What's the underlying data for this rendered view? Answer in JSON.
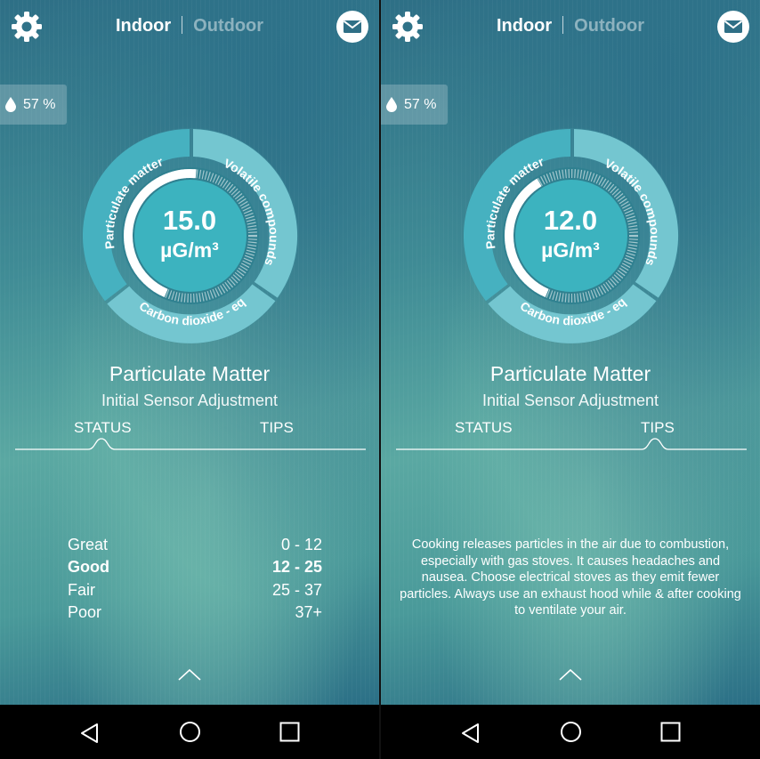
{
  "screens": [
    {
      "header": {
        "tab_indoor": "Indoor",
        "tab_outdoor": "Outdoor",
        "settings_icon": "gear-icon",
        "mail_icon": "mail-icon"
      },
      "humidity": "57 %",
      "dial": {
        "segments": [
          "Particulate matter",
          "Volatile compounds",
          "Carbon dioxide - eq"
        ],
        "value": "15.0",
        "unit": "µG/m³",
        "gauge_fill_fraction": 0.45
      },
      "title": "Particulate Matter",
      "subtitle": "Initial Sensor Adjustment",
      "tabs": {
        "status": "STATUS",
        "tips": "TIPS",
        "active": "status"
      },
      "ranges": [
        {
          "label": "Great",
          "range": "0 - 12"
        },
        {
          "label": "Good",
          "range": "12 - 25",
          "highlight": true
        },
        {
          "label": "Fair",
          "range": "25 - 37"
        },
        {
          "label": "Poor",
          "range": "37+"
        }
      ]
    },
    {
      "header": {
        "tab_indoor": "Indoor",
        "tab_outdoor": "Outdoor",
        "settings_icon": "gear-icon",
        "mail_icon": "mail-icon"
      },
      "humidity": "57 %",
      "dial": {
        "segments": [
          "Particulate matter",
          "Volatile compounds",
          "Carbon dioxide - eq"
        ],
        "value": "12.0",
        "unit": "µG/m³",
        "gauge_fill_fraction": 0.35
      },
      "title": "Particulate Matter",
      "subtitle": "Initial Sensor Adjustment",
      "tabs": {
        "status": "STATUS",
        "tips": "TIPS",
        "active": "tips"
      },
      "tips_text": "Cooking releases particles in the air due to combustion, especially with gas stoves. It causes headaches and nausea. Choose electrical stoves as they emit fewer particles. Always use an exhaust hood while & after cooking to ventilate your air."
    }
  ],
  "navbar": {
    "back_icon": "back-triangle-icon",
    "home_icon": "home-circle-icon",
    "recents_icon": "recents-square-icon"
  },
  "colors": {
    "segment_active": "#46b1c0",
    "segment_inactive": "#74c6d0",
    "center": "#3cb3bf"
  }
}
